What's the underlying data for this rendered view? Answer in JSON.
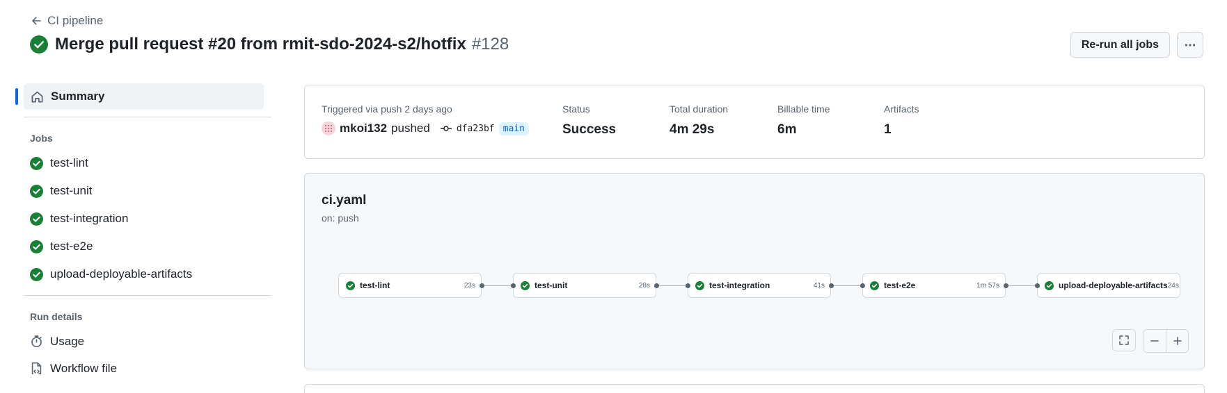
{
  "header": {
    "back_label": "CI pipeline",
    "title": "Merge pull request #20 from rmit-sdo-2024-s2/hotfix",
    "run_number": "#128",
    "rerun_label": "Re-run all jobs",
    "status_color": "#1a7f37"
  },
  "sidebar": {
    "summary_label": "Summary",
    "jobs_heading": "Jobs",
    "jobs": [
      {
        "label": "test-lint"
      },
      {
        "label": "test-unit"
      },
      {
        "label": "test-integration"
      },
      {
        "label": "test-e2e"
      },
      {
        "label": "upload-deployable-artifacts"
      }
    ],
    "run_details_heading": "Run details",
    "run_details": [
      {
        "label": "Usage",
        "icon": "stopwatch-icon"
      },
      {
        "label": "Workflow file",
        "icon": "file-code-icon"
      }
    ]
  },
  "info": {
    "trigger_label": "Triggered via push 2 days ago",
    "actor": "mkoi132",
    "action": "pushed",
    "sha": "dfa23bf",
    "branch": "main",
    "status_label": "Status",
    "status_value": "Success",
    "duration_label": "Total duration",
    "duration_value": "4m 29s",
    "billable_label": "Billable time",
    "billable_value": "6m",
    "artifacts_label": "Artifacts",
    "artifacts_value": "1"
  },
  "workflow": {
    "name": "ci.yaml",
    "trigger": "on: push",
    "jobs": [
      {
        "name": "test-lint",
        "time": "23s"
      },
      {
        "name": "test-unit",
        "time": "28s"
      },
      {
        "name": "test-integration",
        "time": "41s"
      },
      {
        "name": "test-e2e",
        "time": "1m 57s"
      },
      {
        "name": "upload-deployable-artifacts",
        "time": "24s"
      }
    ]
  }
}
